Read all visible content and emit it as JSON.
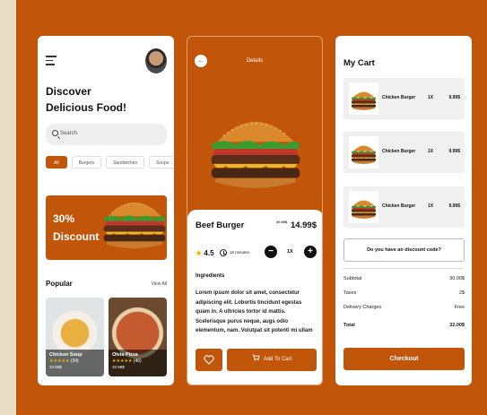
{
  "colors": {
    "accent": "#c1550a",
    "background": "#e8dcc4",
    "star": "#f6b400"
  },
  "home": {
    "headline_line1": "Discover",
    "headline_line2": "Delicious Food!",
    "search_placeholder": "Search",
    "categories": [
      "All",
      "Burgers",
      "Sandwiches",
      "Soups"
    ],
    "promo_line1": "30%",
    "promo_line2": "Discount",
    "popular_title": "Popular",
    "view_all": "View All",
    "items": [
      {
        "name": "Chicken Soup",
        "stars": "★★★★★",
        "reviews": "(34)",
        "price": "10.99$"
      },
      {
        "name": "Olvia Pizza",
        "stars": "★★★★★",
        "reviews": "(46)",
        "price": "10.99$"
      }
    ]
  },
  "details": {
    "title": "Details",
    "item_name": "Beef Burger",
    "old_price": "20.99$",
    "price": "14.99$",
    "rating": "4.5",
    "time": "15 minutes",
    "quantity": "1X",
    "ingredients_title": "Ingredients",
    "ingredients_text": "Lorem ipsum dolor sit amet, consectetur adipiscing elit. Lobortis tincidunt egestas quam in. A ultricies tortor id mattis. Scelerisque purus neque, augs odio elementum, nam. Volutpat sit potenti mi ullam",
    "add_to_cart": "Add To Cart"
  },
  "cart": {
    "title": "My Cart",
    "items": [
      {
        "name": "Chicken Burger",
        "qty": "1X",
        "price": "9.99$"
      },
      {
        "name": "Chicken Burger",
        "qty": "1X",
        "price": "9.99$"
      },
      {
        "name": "Chicken Burger",
        "qty": "1X",
        "price": "9.99$"
      }
    ],
    "discount_prompt": "Do you have an discount code?",
    "subtotal_label": "Subtotal",
    "subtotal_value": "30.00$",
    "taxes_label": "Taxes",
    "taxes_value": "2$",
    "delivery_label": "Delivery Charges",
    "delivery_value": "Free",
    "total_label": "Total",
    "total_value": "32.00$",
    "checkout": "Checkout"
  }
}
